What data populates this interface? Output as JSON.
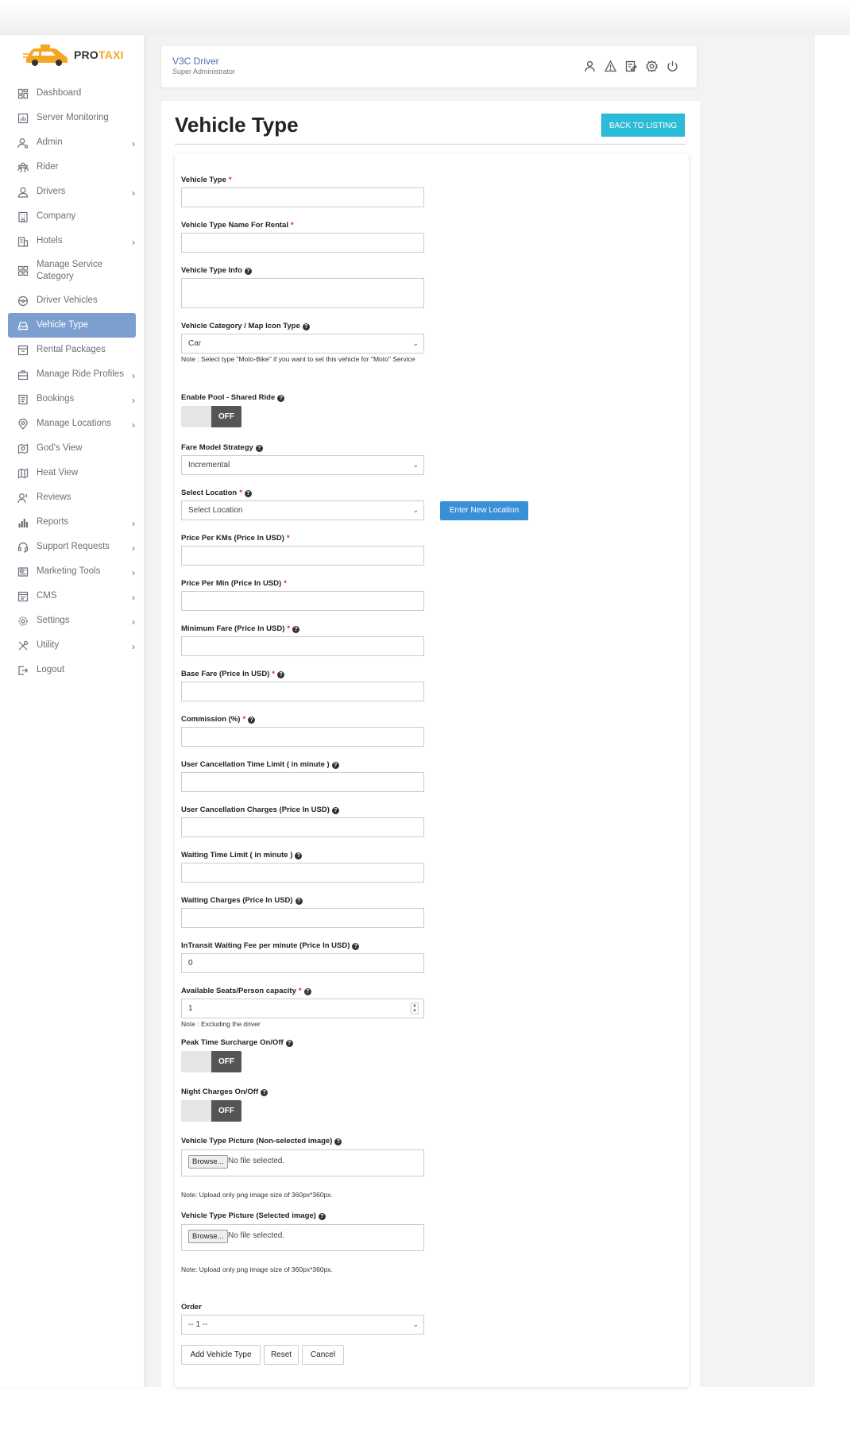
{
  "brand": {
    "pro": "PRO",
    "taxi": "TAXI"
  },
  "sidebar": {
    "items": [
      {
        "label": "Dashboard",
        "icon": "dashboard-icon",
        "chevron": false
      },
      {
        "label": "Server Monitoring",
        "icon": "chart-icon",
        "chevron": false
      },
      {
        "label": "Admin",
        "icon": "user-gear-icon",
        "chevron": true
      },
      {
        "label": "Rider",
        "icon": "users-icon",
        "chevron": false
      },
      {
        "label": "Drivers",
        "icon": "user-icon",
        "chevron": true
      },
      {
        "label": "Company",
        "icon": "building-icon",
        "chevron": false
      },
      {
        "label": "Hotels",
        "icon": "hotel-icon",
        "chevron": true
      },
      {
        "label": "Manage Service Category",
        "icon": "grid-icon",
        "chevron": false
      },
      {
        "label": "Driver Vehicles",
        "icon": "steering-icon",
        "chevron": false
      },
      {
        "label": "Vehicle Type",
        "icon": "car-icon",
        "chevron": false,
        "active": true
      },
      {
        "label": "Rental Packages",
        "icon": "package-icon",
        "chevron": false
      },
      {
        "label": "Manage Ride Profiles",
        "icon": "briefcase-icon",
        "chevron": true
      },
      {
        "label": "Bookings",
        "icon": "book-icon",
        "chevron": true
      },
      {
        "label": "Manage Locations",
        "icon": "location-icon",
        "chevron": true
      },
      {
        "label": "God's View",
        "icon": "map-search-icon",
        "chevron": false
      },
      {
        "label": "Heat View",
        "icon": "map-icon",
        "chevron": false
      },
      {
        "label": "Reviews",
        "icon": "reviews-icon",
        "chevron": false
      },
      {
        "label": "Reports",
        "icon": "bar-chart-icon",
        "chevron": true
      },
      {
        "label": "Support Requests",
        "icon": "headset-icon",
        "chevron": true
      },
      {
        "label": "Marketing Tools",
        "icon": "newspaper-icon",
        "chevron": true
      },
      {
        "label": "CMS",
        "icon": "cms-icon",
        "chevron": true
      },
      {
        "label": "Settings",
        "icon": "gear-icon",
        "chevron": true
      },
      {
        "label": "Utility",
        "icon": "tools-icon",
        "chevron": true
      },
      {
        "label": "Logout",
        "icon": "logout-icon",
        "chevron": false
      }
    ]
  },
  "header": {
    "user_name": "V3C Driver",
    "user_role": "Super Administrator"
  },
  "page": {
    "title": "Vehicle Type",
    "back_button": "BACK TO LISTING"
  },
  "form": {
    "vehicle_type": {
      "label": "Vehicle Type",
      "value": ""
    },
    "rental_name": {
      "label": "Vehicle Type Name For Rental",
      "value": ""
    },
    "type_info": {
      "label": "Vehicle Type Info",
      "value": ""
    },
    "category": {
      "label": "Vehicle Category / Map Icon Type",
      "value": "Car",
      "note": "Note : Select type \"Moto-Bike\" if you want to set this vehicle for \"Moto\" Service"
    },
    "pool": {
      "label": "Enable Pool - Shared Ride",
      "state": "OFF"
    },
    "fare_model": {
      "label": "Fare Model Strategy",
      "value": "Incremental"
    },
    "location": {
      "label": "Select Location",
      "value": "Select Location",
      "new_button": "Enter New Location"
    },
    "price_km": {
      "label": "Price Per KMs (Price In USD)",
      "value": ""
    },
    "price_min": {
      "label": "Price Per Min (Price In USD)",
      "value": ""
    },
    "min_fare": {
      "label": "Minimum Fare (Price In USD)",
      "value": ""
    },
    "base_fare": {
      "label": "Base Fare (Price In USD)",
      "value": ""
    },
    "commission": {
      "label": "Commission (%)",
      "value": ""
    },
    "cancel_limit": {
      "label": "User Cancellation Time Limit ( in minute )",
      "value": ""
    },
    "cancel_charges": {
      "label": "User Cancellation Charges (Price In USD)",
      "value": ""
    },
    "wait_limit": {
      "label": "Waiting Time Limit ( in minute )",
      "value": ""
    },
    "wait_charges": {
      "label": "Waiting Charges (Price In USD)",
      "value": ""
    },
    "transit_fee": {
      "label": "InTransit Waiting Fee per minute (Price In USD)",
      "value": "0"
    },
    "seats": {
      "label": "Available Seats/Person capacity",
      "value": "1",
      "note": "Note : Excluding the driver"
    },
    "peak": {
      "label": "Peak Time Surcharge On/Off",
      "state": "OFF"
    },
    "night": {
      "label": "Night Charges On/Off",
      "state": "OFF"
    },
    "pic_nonselected": {
      "label": "Vehicle Type Picture (Non-selected image)",
      "browse": "Browse...",
      "file": "No file selected.",
      "note": "Note: Upload only png image size of 360px*360px."
    },
    "pic_selected": {
      "label": "Vehicle Type Picture (Selected image)",
      "browse": "Browse...",
      "file": "No file selected.",
      "note": "Note: Upload only png image size of 360px*360px."
    },
    "order": {
      "label": "Order",
      "value": "-- 1 --"
    },
    "buttons": {
      "add": "Add Vehicle Type",
      "reset": "Reset",
      "cancel": "Cancel"
    }
  },
  "colors": {
    "accent": "#2bbcd8",
    "active_menu": "#7d9fd0",
    "primary_button": "#3a8fd9",
    "required": "#e02424",
    "brand_taxi": "#f5a623"
  }
}
